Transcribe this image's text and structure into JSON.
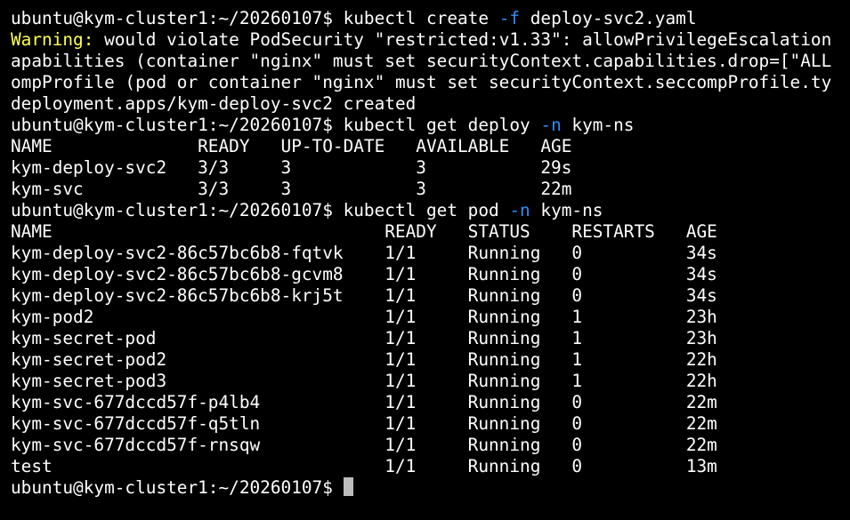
{
  "terminal": {
    "background": "#000000",
    "text_color": "#ffffff",
    "warning_color": "#ffff55",
    "flag_color": "#2f8cff",
    "cursor_color": "#bcbcbc"
  },
  "lines": [
    {
      "segments": [
        {
          "text": "ubuntu@kym-cluster1:~/20260107$ kubectl create "
        },
        {
          "text": "-f",
          "style": "flag"
        },
        {
          "text": " deploy-svc2.yaml"
        }
      ]
    },
    {
      "segments": [
        {
          "text": "Warning:",
          "style": "warn"
        },
        {
          "text": " would violate PodSecurity \"restricted:v1.33\": allowPrivilegeEscalation"
        }
      ]
    },
    {
      "segments": [
        {
          "text": "apabilities (container \"nginx\" must set securityContext.capabilities.drop=[\"ALL"
        }
      ]
    },
    {
      "segments": [
        {
          "text": "ompProfile (pod or container \"nginx\" must set securityContext.seccompProfile.ty"
        }
      ]
    },
    {
      "segments": [
        {
          "text": "deployment.apps/kym-deploy-svc2 created"
        }
      ]
    },
    {
      "segments": [
        {
          "text": "ubuntu@kym-cluster1:~/20260107$ kubectl get deploy "
        },
        {
          "text": "-n",
          "style": "flag"
        },
        {
          "text": " kym-ns"
        }
      ]
    },
    {
      "segments": [
        {
          "text": "NAME              READY   UP-TO-DATE   AVAILABLE   AGE"
        }
      ]
    },
    {
      "segments": [
        {
          "text": "kym-deploy-svc2   3/3     3            3           29s"
        }
      ]
    },
    {
      "segments": [
        {
          "text": "kym-svc           3/3     3            3           22m"
        }
      ]
    },
    {
      "segments": [
        {
          "text": "ubuntu@kym-cluster1:~/20260107$ kubectl get pod "
        },
        {
          "text": "-n",
          "style": "flag"
        },
        {
          "text": " kym-ns"
        }
      ]
    },
    {
      "segments": [
        {
          "text": "NAME                                READY   STATUS    RESTARTS   AGE"
        }
      ]
    },
    {
      "segments": [
        {
          "text": "kym-deploy-svc2-86c57bc6b8-fqtvk    1/1     Running   0          34s"
        }
      ]
    },
    {
      "segments": [
        {
          "text": "kym-deploy-svc2-86c57bc6b8-gcvm8    1/1     Running   0          34s"
        }
      ]
    },
    {
      "segments": [
        {
          "text": "kym-deploy-svc2-86c57bc6b8-krj5t    1/1     Running   0          34s"
        }
      ]
    },
    {
      "segments": [
        {
          "text": "kym-pod2                            1/1     Running   1          23h"
        }
      ]
    },
    {
      "segments": [
        {
          "text": "kym-secret-pod                      1/1     Running   1          23h"
        }
      ]
    },
    {
      "segments": [
        {
          "text": "kym-secret-pod2                     1/1     Running   1          22h"
        }
      ]
    },
    {
      "segments": [
        {
          "text": "kym-secret-pod3                     1/1     Running   1          22h"
        }
      ]
    },
    {
      "segments": [
        {
          "text": "kym-svc-677dccd57f-p4lb4            1/1     Running   0          22m"
        }
      ]
    },
    {
      "segments": [
        {
          "text": "kym-svc-677dccd57f-q5tln            1/1     Running   0          22m"
        }
      ]
    },
    {
      "segments": [
        {
          "text": "kym-svc-677dccd57f-rnsqw            1/1     Running   0          22m"
        }
      ]
    },
    {
      "segments": [
        {
          "text": "test                                1/1     Running   0          13m"
        }
      ]
    },
    {
      "segments": [
        {
          "text": "ubuntu@kym-cluster1:~/20260107$ "
        }
      ],
      "cursor": true
    }
  ]
}
